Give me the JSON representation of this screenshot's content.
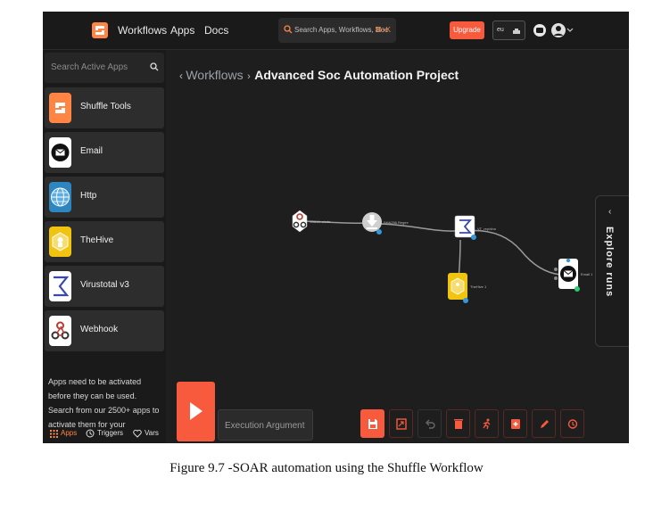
{
  "topbar": {
    "logo_icon": "shuffle-logo-icon",
    "nav": [
      "Workflows",
      "Apps",
      "Docs"
    ],
    "search_placeholder": "Search Apps, Workflows, Doc",
    "search_shortcut": "⌘+K",
    "upgrade_label": "Upgrade",
    "org_label": "eu",
    "icons": [
      "chat-icon",
      "account-icon",
      "chevron-down-icon"
    ],
    "accent": "#ff8544",
    "brand_red": "#f85a3e"
  },
  "sidebar": {
    "search_placeholder": "Search Active Apps",
    "apps": [
      {
        "name": "Shuffle Tools",
        "icon": "shuffle-tools-icon"
      },
      {
        "name": "Email",
        "icon": "email-icon"
      },
      {
        "name": "Http",
        "icon": "http-globe-icon"
      },
      {
        "name": "TheHive",
        "icon": "thehive-icon"
      },
      {
        "name": "Virustotal v3",
        "icon": "virustotal-icon"
      },
      {
        "name": "Webhook",
        "icon": "webhook-icon"
      }
    ],
    "note": "Apps need to be activated before they can be used. Search from our 2500+ apps to activate them for your",
    "tabs": [
      "Apps",
      "Triggers",
      "Vars"
    ]
  },
  "breadcrumb": {
    "back_icon": "back-arrow-icon",
    "parent": "Workflows",
    "separator": "›",
    "title": "Advanced Soc Automation Project"
  },
  "workflow": {
    "nodes": [
      {
        "label": "Wazuh-alerts",
        "type": "webhook-trigger"
      },
      {
        "label": "SHA256 Regex",
        "type": "shuffle-tools"
      },
      {
        "label": "VT_rep/sha",
        "type": "virustotal"
      },
      {
        "label": "TheHive 1",
        "type": "thehive"
      },
      {
        "label": "Email 1",
        "type": "email"
      }
    ]
  },
  "explore_runs": {
    "label": "Explore runs",
    "chevron": "‹"
  },
  "toolbar": {
    "execution_placeholder": "Execution Argument",
    "buttons": [
      "run-icon",
      "save-icon",
      "fullscreen-icon",
      "undo-icon",
      "delete-icon",
      "runner-icon",
      "add-icon",
      "edit-icon",
      "history-icon"
    ]
  },
  "caption": "Figure 9.7 -SOAR automation using the Shuffle Workflow"
}
